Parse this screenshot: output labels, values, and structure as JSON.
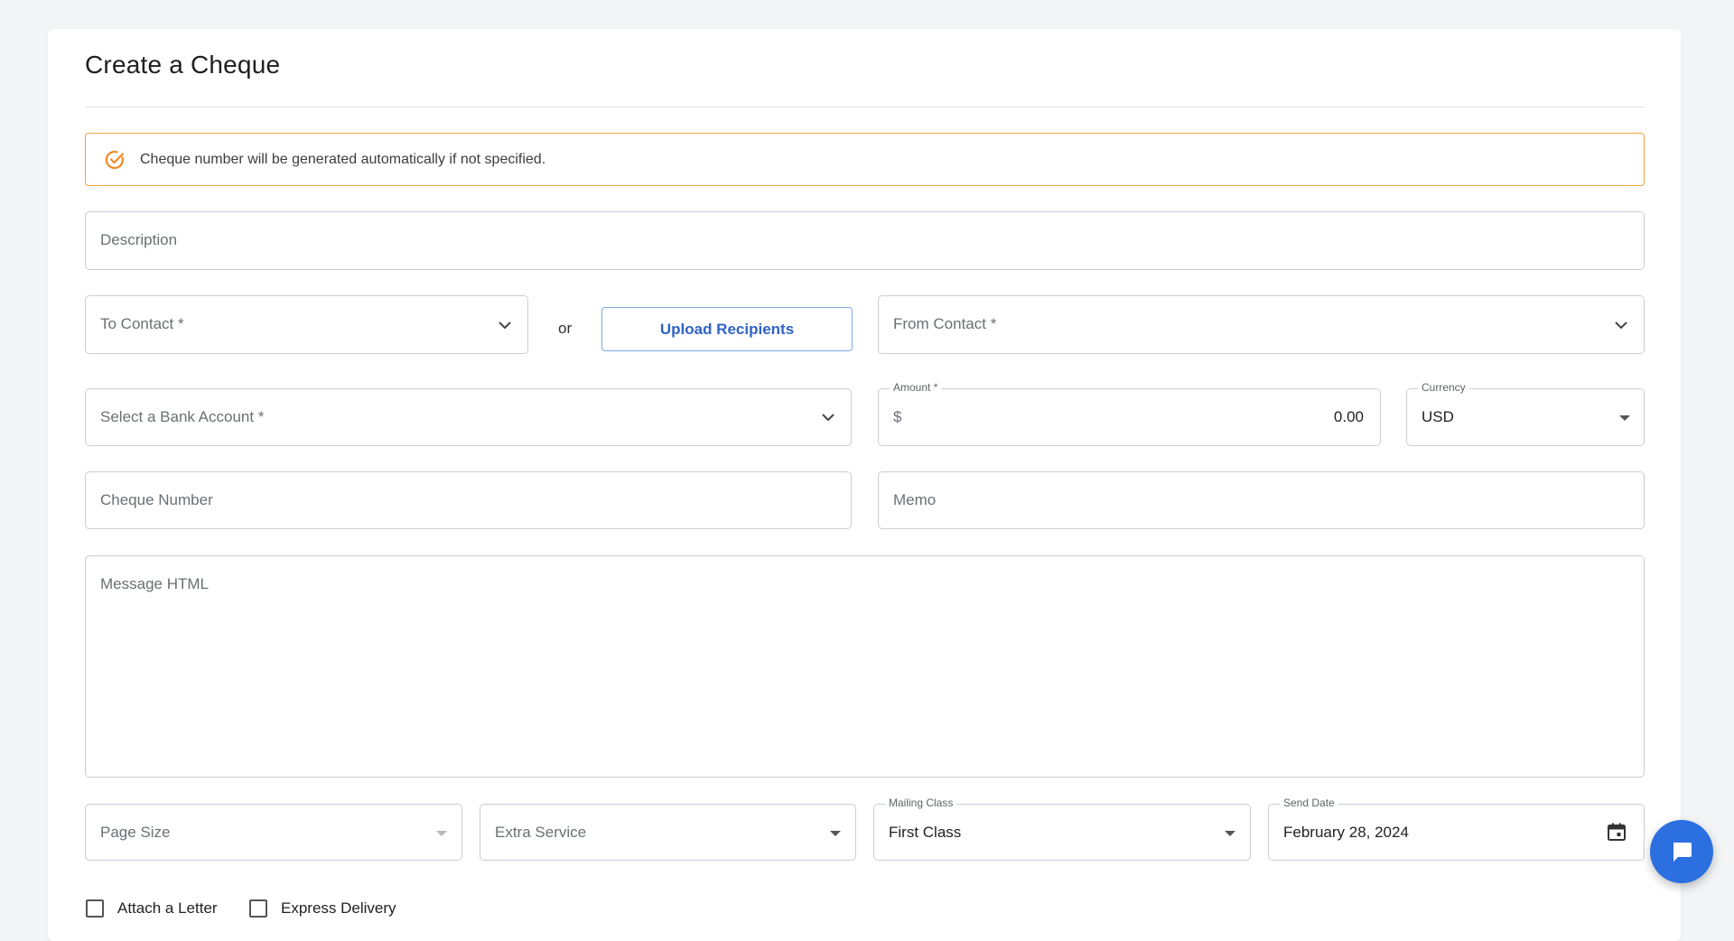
{
  "page": {
    "title": "Create a Cheque"
  },
  "alert": {
    "text": "Cheque number will be generated automatically if not specified.",
    "icon": "check-circle-icon",
    "color": "#f0a63c"
  },
  "form": {
    "description_placeholder": "Description",
    "to_contact_placeholder": "To Contact *",
    "or_label": "or",
    "upload_button_label": "Upload Recipients",
    "from_contact_placeholder": "From Contact *",
    "bank_account_placeholder": "Select a Bank Account *",
    "amount": {
      "label": "Amount *",
      "prefix": "$",
      "value": "0.00"
    },
    "currency": {
      "label": "Currency",
      "value": "USD"
    },
    "cheque_number_placeholder": "Cheque Number",
    "memo_placeholder": "Memo",
    "message_html_placeholder": "Message HTML",
    "page_size_placeholder": "Page Size",
    "extra_service_placeholder": "Extra Service",
    "mailing_class": {
      "label": "Mailing Class",
      "value": "First Class"
    },
    "send_date": {
      "label": "Send Date",
      "value": "February 28, 2024"
    },
    "attach_letter_label": "Attach a Letter",
    "express_delivery_label": "Express Delivery"
  },
  "colors": {
    "accent": "#2f63c6",
    "chat_button": "#2b6fe0",
    "alert_border": "#f0a63c"
  }
}
